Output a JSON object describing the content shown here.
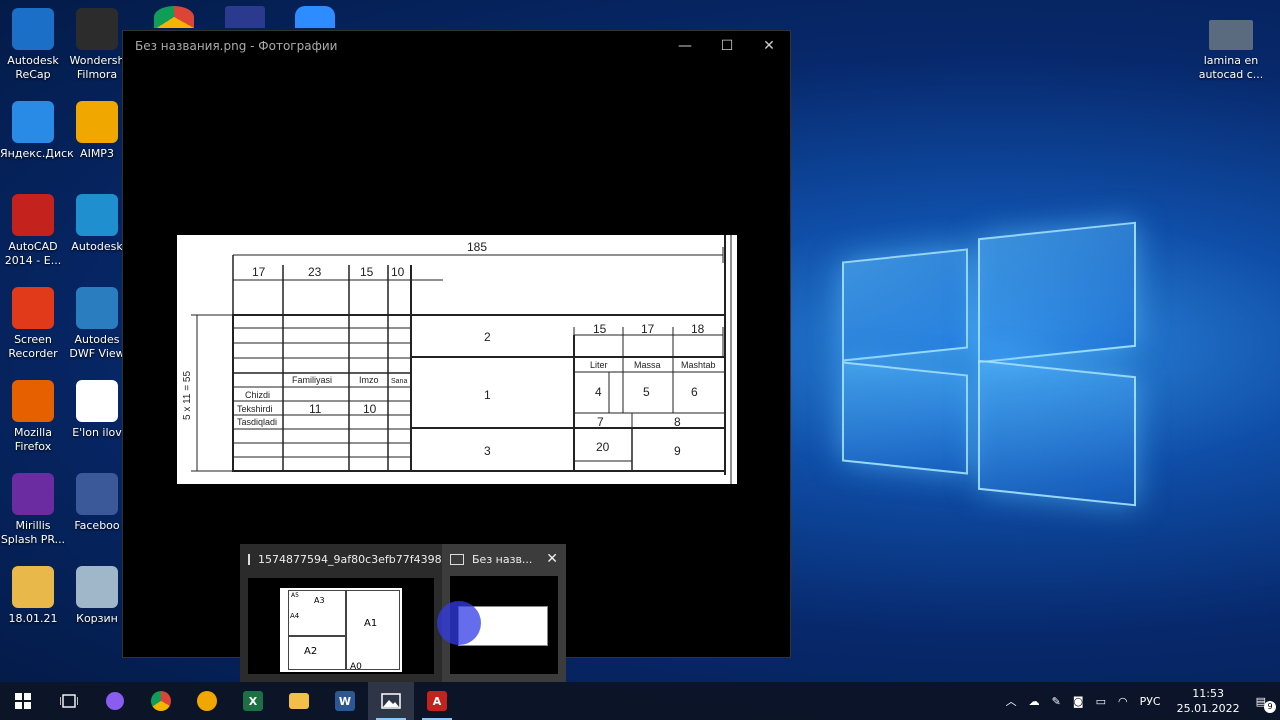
{
  "desktop": {
    "left_icons": [
      {
        "label": "Autodesk ReCap",
        "color": "#1b6fc7"
      },
      {
        "label": "Wondersh Filmora",
        "color": "#2c2c2c"
      },
      {
        "label": "Яндекс.Диск",
        "color": "#2a8be6"
      },
      {
        "label": "AIMP3",
        "color": "#f0a800"
      },
      {
        "label": "AutoCAD 2014 - E...",
        "color": "#c4221c"
      },
      {
        "label": "Autodesk",
        "color": "#1f8fd0"
      },
      {
        "label": "Screen Recorder",
        "color": "#e03a1a"
      },
      {
        "label": "Autodes DWF View",
        "color": "#2a7ec0"
      },
      {
        "label": "Mozilla Firefox",
        "color": "#e66000"
      },
      {
        "label": "E'lon ilov",
        "color": "#ffffff"
      },
      {
        "label": "Mirillis Splash PR...",
        "color": "#6a2ca0"
      },
      {
        "label": "Faceboo",
        "color": "#3b5998"
      },
      {
        "label": "18.01.21",
        "color": "#e8b84a"
      },
      {
        "label": "Корзин",
        "color": "#9fb7c8"
      }
    ],
    "top_icons": [
      {
        "name": "chrome",
        "color": "#db4437"
      },
      {
        "name": "save",
        "color": "#2b3a8f"
      },
      {
        "name": "zoom",
        "color": "#2d8cff"
      }
    ],
    "right_icon": {
      "label": "lamina en autocad c..."
    }
  },
  "photo_window": {
    "title": "Без названия.png - Фотографии",
    "controls": {
      "minimize": "—",
      "maximize": "☐",
      "close": "✕"
    }
  },
  "drawing": {
    "dim_total": "185",
    "dims_top": [
      "17",
      "23",
      "15",
      "10"
    ],
    "dims_right": [
      "15",
      "17",
      "18"
    ],
    "dim_vertical": "5 x 11 = 55",
    "cols": [
      "Familiyasi",
      "Imzo",
      "Sana"
    ],
    "rows": [
      "Chizdi",
      "Tekshirdi",
      "Tasdiqladi"
    ],
    "cell_11": "11",
    "cell_10": "10",
    "cell_2": "2",
    "cell_1": "1",
    "cell_3": "3",
    "liter": "Liter",
    "massa": "Massa",
    "mashtab": "Mashtab",
    "cell_4": "4",
    "cell_5": "5",
    "cell_6": "6",
    "cell_7": "7",
    "cell_8": "8",
    "cell_9": "9",
    "cell_20": "20"
  },
  "thumbnails": [
    {
      "title": "1574877594_9af80c3efb77f4398...",
      "sheet_labels": [
        "A5",
        "A3",
        "A4",
        "A1",
        "A2",
        "A0"
      ]
    },
    {
      "title": "Без назв...",
      "close": "✕"
    }
  ],
  "taskbar": {
    "buttons": [
      "start",
      "task-view",
      "cortana",
      "chrome",
      "aimp",
      "excel",
      "explorer",
      "word",
      "photos",
      "autocad"
    ],
    "tray": {
      "lang": "РУС",
      "time": "11:53",
      "date": "25.01.2022",
      "notifications": "9"
    }
  }
}
